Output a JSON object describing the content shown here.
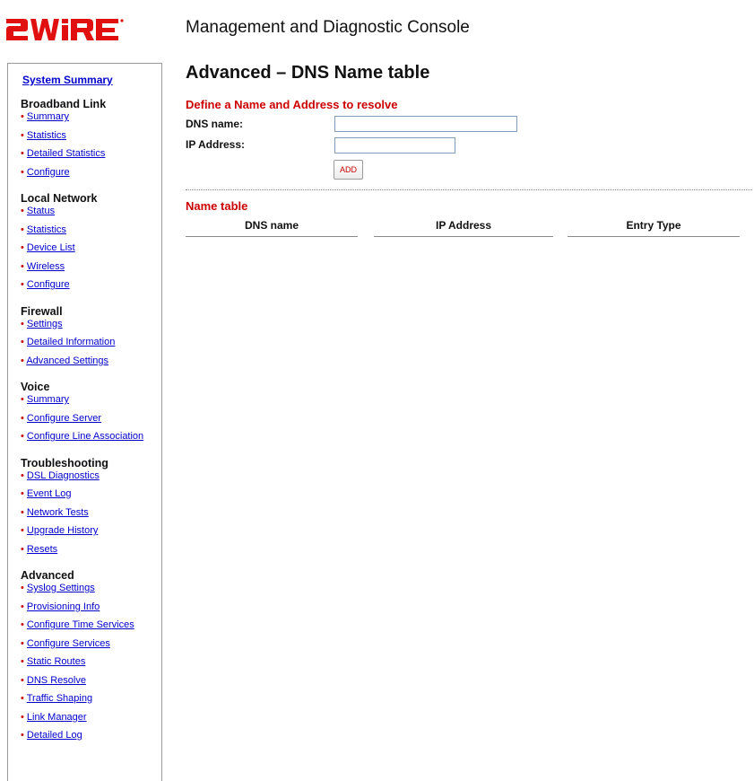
{
  "brand": {
    "logo_text": "2wire",
    "console_title": "Management and Diagnostic Console"
  },
  "sidebar": {
    "summary_link": "System Summary",
    "sections": [
      {
        "title": "Broadband Link",
        "items": [
          "Summary",
          "Statistics",
          "Detailed Statistics",
          "Configure"
        ]
      },
      {
        "title": "Local Network",
        "items": [
          "Status",
          "Statistics",
          "Device List",
          "Wireless",
          "Configure"
        ]
      },
      {
        "title": "Firewall",
        "items": [
          "Settings",
          "Detailed Information",
          "Advanced Settings"
        ]
      },
      {
        "title": "Voice",
        "items": [
          "Summary",
          "Configure Server",
          "Configure Line Association"
        ]
      },
      {
        "title": "Troubleshooting",
        "items": [
          "DSL Diagnostics",
          "Event Log",
          "Network Tests",
          "Upgrade History",
          "Resets"
        ]
      },
      {
        "title": "Advanced",
        "items": [
          "Syslog Settings",
          "Provisioning Info",
          "Configure Time Services",
          "Configure Services",
          "Static Routes",
          "DNS Resolve",
          "Traffic Shaping",
          "Link Manager",
          "Detailed Log"
        ]
      }
    ]
  },
  "main": {
    "title": "Advanced – DNS Name table",
    "define_heading": "Define a Name and Address to resolve",
    "dns_name_label": "DNS name:",
    "dns_name_value": "",
    "ip_address_label": "IP Address:",
    "ip_address_value": "",
    "add_button": "ADD",
    "table_heading": "Name table",
    "columns": [
      "DNS name",
      "IP Address",
      "Entry Type"
    ],
    "rows": []
  },
  "colors": {
    "accent_red": "#cc0000",
    "link_blue": "#0000cc",
    "logo_red": "#e01010"
  }
}
